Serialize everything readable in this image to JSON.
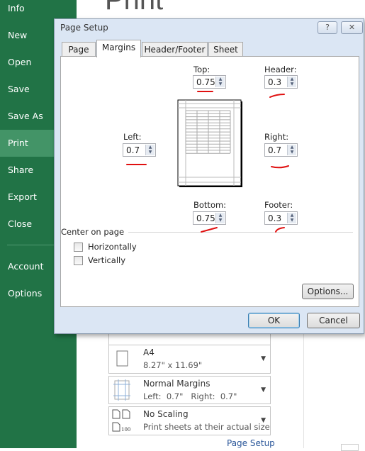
{
  "sidebar": {
    "items": [
      {
        "label": "Info"
      },
      {
        "label": "New"
      },
      {
        "label": "Open"
      },
      {
        "label": "Save"
      },
      {
        "label": "Save As"
      },
      {
        "label": "Print",
        "selected": true
      },
      {
        "label": "Share"
      },
      {
        "label": "Export"
      },
      {
        "label": "Close"
      },
      {
        "label": "Account"
      },
      {
        "label": "Options"
      }
    ],
    "color": "#217346"
  },
  "main": {
    "title": "Print",
    "settings": [
      {
        "title": "A4",
        "subtitle": "8.27\" x 11.69\"",
        "icon": "paper-size-icon"
      },
      {
        "title": "Normal Margins",
        "subtitle": "Left:  0.7\"   Right:  0.7\"",
        "icon": "margins-icon"
      },
      {
        "title": "No Scaling",
        "subtitle": "Print sheets at their actual size",
        "icon": "scaling-icon"
      }
    ],
    "page_setup_link": "Page Setup"
  },
  "dialog": {
    "title": "Page Setup",
    "help": "?",
    "close": "✕",
    "tabs": [
      {
        "label": "Page"
      },
      {
        "label": "Margins",
        "selected": true
      },
      {
        "label": "Header/Footer"
      },
      {
        "label": "Sheet"
      }
    ],
    "fields": {
      "top": {
        "label": "Top:",
        "value": "0.75"
      },
      "header": {
        "label": "Header:",
        "value": "0.3"
      },
      "left": {
        "label": "Left:",
        "value": "0.7"
      },
      "right": {
        "label": "Right:",
        "value": "0.7"
      },
      "bottom": {
        "label": "Bottom:",
        "value": "0.75"
      },
      "footer": {
        "label": "Footer:",
        "value": "0.3"
      }
    },
    "center_on_page": "Center on page",
    "horizontally": {
      "label": "Horizontally",
      "checked": false
    },
    "vertically": {
      "label": "Vertically",
      "checked": false
    },
    "options": "Options...",
    "ok": "OK",
    "cancel": "Cancel"
  },
  "annotation_color": "#e01010"
}
